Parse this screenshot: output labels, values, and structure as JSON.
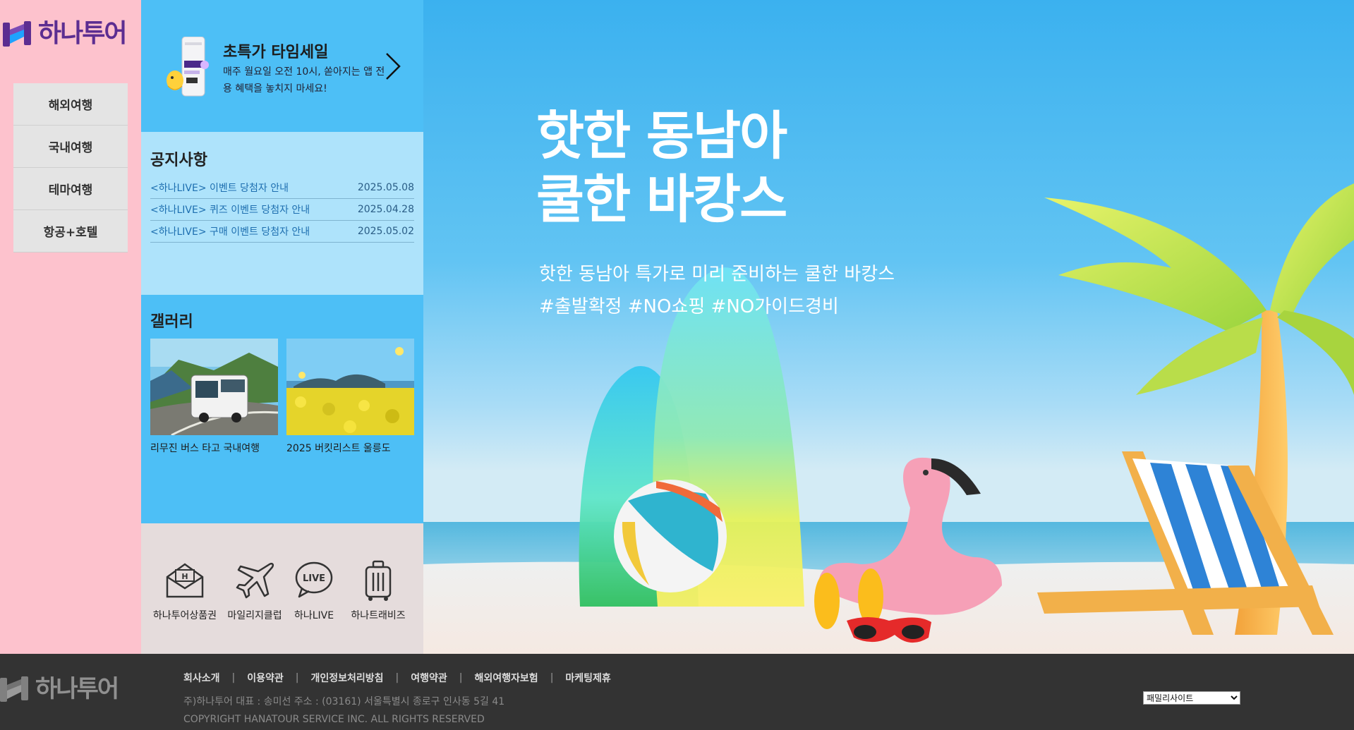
{
  "brand": {
    "logo_text": "하나투어",
    "accent": "#5c2d91"
  },
  "nav": {
    "items": [
      {
        "label": "해외여행"
      },
      {
        "label": "국내여행"
      },
      {
        "label": "테마여행"
      },
      {
        "label": "항공+호텔"
      }
    ]
  },
  "promo": {
    "title": "초특가 타임세일",
    "description": "매주 월요일 오전 10시, 쏟아지는 앱 전용 혜택을 놓치지 마세요!",
    "phone_label": "타임세일",
    "arrow_icon": "chevron-right-icon"
  },
  "notice": {
    "title": "공지사항",
    "items": [
      {
        "text": "<하나LIVE> 이벤트 당첨자 안내",
        "date": "2025.05.08"
      },
      {
        "text": "<하나LIVE> 퀴즈 이벤트 당첨자 안내",
        "date": "2025.04.28"
      },
      {
        "text": "<하나LIVE> 구매 이벤트 당첨자 안내",
        "date": "2025.05.02"
      }
    ]
  },
  "gallery": {
    "title": "갤러리",
    "items": [
      {
        "caption": "리무진 버스 타고 국내여행"
      },
      {
        "caption": "2025 버킷리스트 울릉도"
      }
    ]
  },
  "quick_links": [
    {
      "label": "하나투어상품권",
      "icon": "voucher-envelope-icon"
    },
    {
      "label": "마일리지클럽",
      "icon": "airplane-icon"
    },
    {
      "label": "하나LIVE",
      "icon": "live-chat-icon"
    },
    {
      "label": "하나트래비즈",
      "icon": "suitcase-icon"
    }
  ],
  "hero": {
    "title_line1": "핫한 동남아",
    "title_line2": "쿨한 바캉스",
    "subtitle_line1": "핫한 동남아 특가로 미리 준비하는 쿨한 바캉스",
    "subtitle_line2": "#출발확정 #NO쇼핑 #NO가이드경비"
  },
  "footer": {
    "logo_text": "하나투어",
    "links": [
      "회사소개",
      "이용약관",
      "개인정보처리방침",
      "여행약관",
      "해외여행자보험",
      "마케팅제휴"
    ],
    "address": "주)하나투어 대표 : 송미선 주소 : (03161) 서울특별시 종로구 인사동 5길 41",
    "copyright": "COPYRIGHT HANATOUR SERVICE INC. ALL RIGHTS RESERVED",
    "family_site_selected": "패밀리사이트"
  }
}
